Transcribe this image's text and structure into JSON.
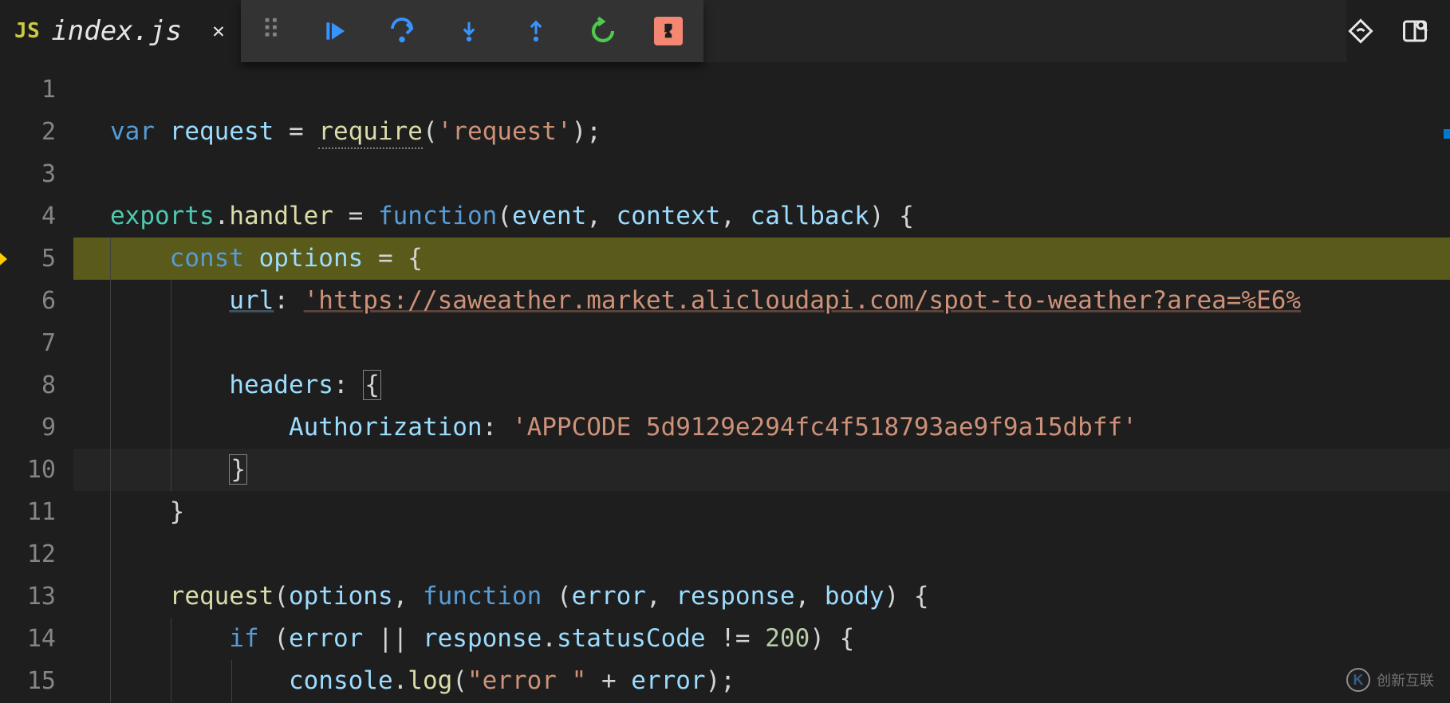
{
  "tab": {
    "lang_badge": "JS",
    "filename": "index.js",
    "close": "✕"
  },
  "debug_toolbar": {
    "buttons": [
      "continue",
      "step-over",
      "step-into",
      "step-out",
      "restart",
      "stop"
    ]
  },
  "code": {
    "lines": [
      "1",
      "2",
      "3",
      "4",
      "5",
      "6",
      "7",
      "8",
      "9",
      "10",
      "11",
      "12",
      "13",
      "14",
      "15"
    ],
    "l2": {
      "var": "var ",
      "id": "request",
      "eq": " = ",
      "fn": "require",
      "op": "(",
      "str": "'request'",
      "cp": ");"
    },
    "l4": {
      "exports": "exports",
      "dot": ".",
      "handler": "handler",
      "eq": " = ",
      "func": "function",
      "op": "(",
      "p1": "event",
      "c1": ", ",
      "p2": "context",
      "c2": ", ",
      "p3": "callback",
      "cp": ") {"
    },
    "l5": {
      "indent": "    ",
      "const": "const ",
      "id": "options",
      "eq": " = {"
    },
    "l6": {
      "indent": "        ",
      "key": "url",
      "colon": ": ",
      "str": "'https://saweather.market.alicloudapi.com/spot-to-weather?area=%E6%"
    },
    "l8": {
      "indent": "        ",
      "key": "headers",
      "colon": ": ",
      "brace": "{"
    },
    "l9": {
      "indent": "            ",
      "key": "Authorization",
      "colon": ": ",
      "str": "'APPCODE 5d9129e294fc4f518793ae9f9a15dbff'"
    },
    "l10": {
      "indent": "        ",
      "brace": "}"
    },
    "l11": {
      "indent": "    ",
      "brace": "}"
    },
    "l13": {
      "indent": "    ",
      "fn": "request",
      "op": "(",
      "p1": "options",
      "c1": ", ",
      "func": "function ",
      "op2": "(",
      "p2": "error",
      "c2": ", ",
      "p3": "response",
      "c3": ", ",
      "p4": "body",
      "cp": ") {"
    },
    "l14": {
      "indent": "        ",
      "if": "if ",
      "op": "(",
      "p1": "error",
      "or": " || ",
      "p2": "response",
      "dot": ".",
      "p3": "statusCode",
      "neq": " != ",
      "num": "200",
      "cp": ") {"
    },
    "l15": {
      "indent": "            ",
      "obj": "console",
      "dot": ".",
      "fn": "log",
      "op": "(",
      "str": "\"error \"",
      "plus": " + ",
      "id": "error",
      "cp": ");"
    }
  },
  "watermark": {
    "icon": "K",
    "text": "创新互联"
  }
}
